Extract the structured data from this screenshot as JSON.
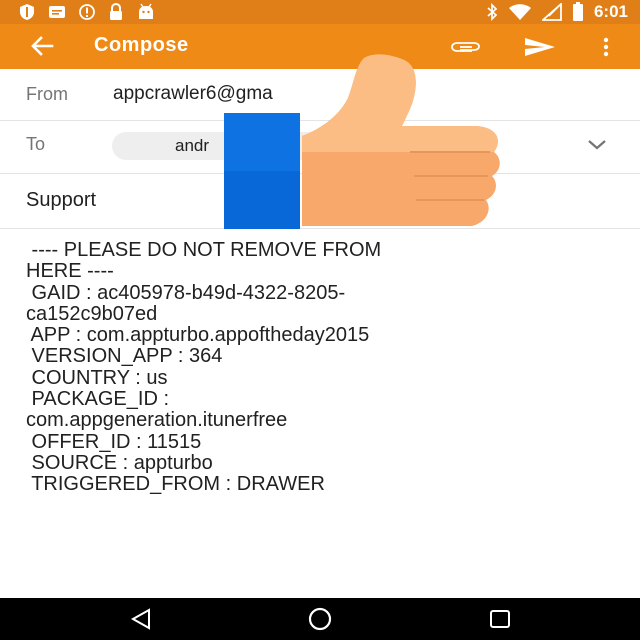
{
  "status_bar": {
    "time": "6:01",
    "left_icons": [
      "shield-icon",
      "message-icon",
      "alert-icon",
      "lock-icon",
      "android-icon"
    ],
    "right_icons": [
      "bluetooth-icon",
      "wifi-icon",
      "signal-icon",
      "battery-icon"
    ]
  },
  "app_bar": {
    "title": "Compose",
    "color": "#ef8a17",
    "icons": [
      "back-arrow-icon",
      "attach-icon",
      "send-icon",
      "more-vert-icon"
    ]
  },
  "from": {
    "label": "From",
    "value": "appcrawler6@gma"
  },
  "to": {
    "label": "To",
    "recipient": "andr"
  },
  "subject": "Support",
  "body": {
    "lines": [
      " ---- PLEASE DO NOT REMOVE FROM",
      "HERE ----",
      "",
      " GAID : ac405978-b49d-4322-8205-",
      "ca152c9b07ed",
      " APP : com.appturbo.appoftheday2015",
      " VERSION_APP : 364",
      " COUNTRY : us",
      " PACKAGE_ID :",
      "com.appgeneration.itunerfree",
      " OFFER_ID : 11515",
      " SOURCE : appturbo",
      " TRIGGERED_FROM : DRAWER"
    ]
  },
  "overlay": {
    "icons": [
      "blue-rectangle",
      "thumbs-up-icon"
    ]
  },
  "nav_bar": {
    "icons": [
      "nav-back-icon",
      "nav-home-icon",
      "nav-recents-icon"
    ]
  }
}
